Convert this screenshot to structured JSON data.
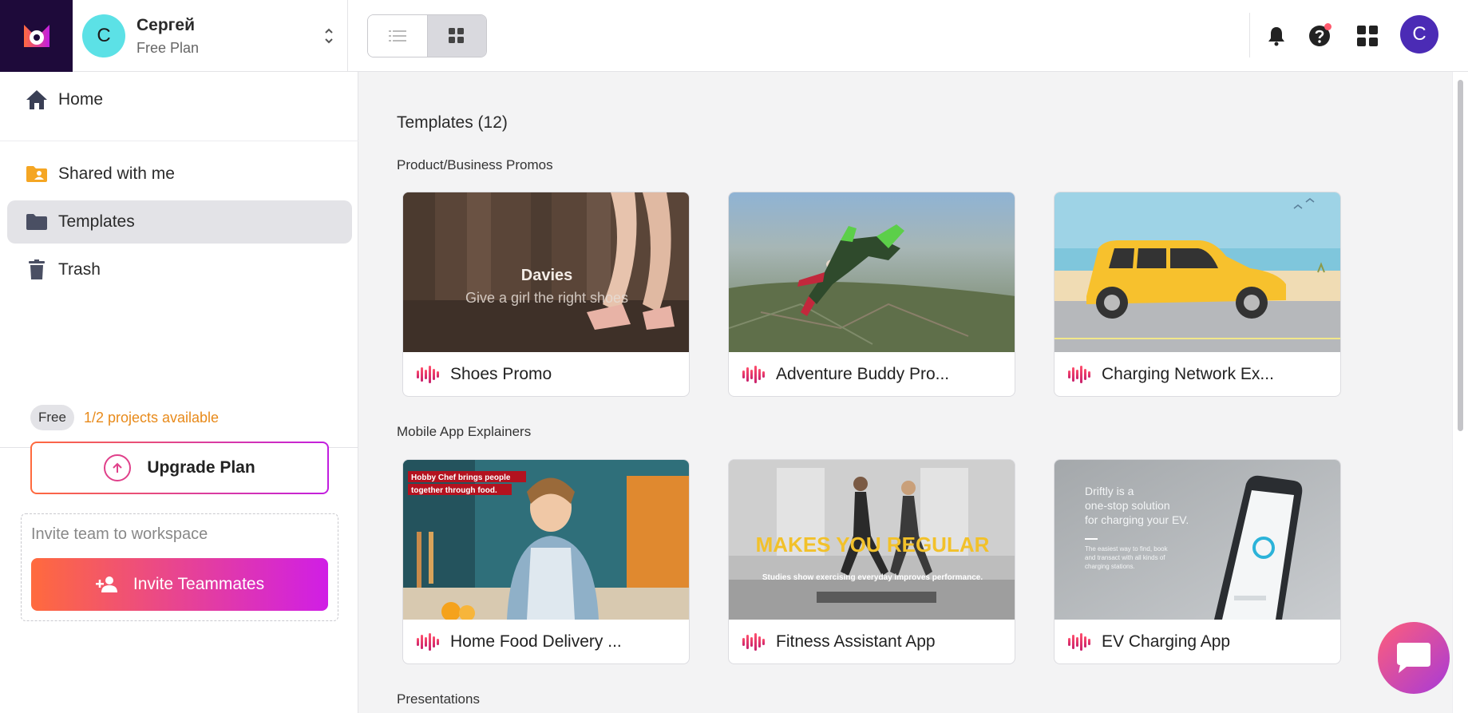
{
  "workspace": {
    "avatar_letter": "С",
    "name": "Сергей",
    "plan": "Free Plan"
  },
  "header": {
    "user_avatar_letter": "C"
  },
  "sidebar": {
    "items": [
      {
        "label": "Home",
        "icon": "home-icon",
        "active": false
      },
      {
        "label": "Shared with me",
        "icon": "shared-folder-icon",
        "active": false
      },
      {
        "label": "Templates",
        "icon": "folder-icon",
        "active": true
      },
      {
        "label": "Trash",
        "icon": "trash-icon",
        "active": false
      }
    ],
    "free_badge": "Free",
    "projects_available": "1/2 projects available",
    "upgrade_label": "Upgrade Plan",
    "invite_text": "Invite team to workspace",
    "invite_label": "Invite Teammates"
  },
  "main": {
    "title": "Templates (12)",
    "sections": [
      {
        "title": "Product/Business Promos",
        "cards": [
          {
            "label": "Shoes Promo",
            "thumb_title": "Davies",
            "thumb_subtitle": "Give a girl the right shoes"
          },
          {
            "label": "Adventure Buddy Pro..."
          },
          {
            "label": "Charging Network Ex..."
          }
        ]
      },
      {
        "title": "Mobile App Explainers",
        "cards": [
          {
            "label": "Home Food Delivery ...",
            "thumb_caption_1": "Hobby Chef brings people",
            "thumb_caption_2": "together through food."
          },
          {
            "label": "Fitness Assistant App",
            "thumb_title": "MAKES YOU REGULAR",
            "thumb_subtitle": "Studies show exercising everyday  improves performance."
          },
          {
            "label": "EV Charging App",
            "thumb_line_1": "Driftly is a",
            "thumb_line_2": "one-stop solution",
            "thumb_line_3": "for charging your EV.",
            "thumb_small_1": "The easiest way to find, book",
            "thumb_small_2": "and transact with all kinds of",
            "thumb_small_3": "charging stations."
          }
        ]
      },
      {
        "title": "Presentations",
        "cards": []
      }
    ]
  },
  "colors": {
    "accent_gradient_start": "#ff6a3d",
    "accent_gradient_end": "#c21ee0",
    "projects_text": "#e88a1a",
    "logo_bg": "#1e0a3a",
    "user_avatar": "#4b2bb5",
    "workspace_avatar": "#5ce1e6"
  }
}
